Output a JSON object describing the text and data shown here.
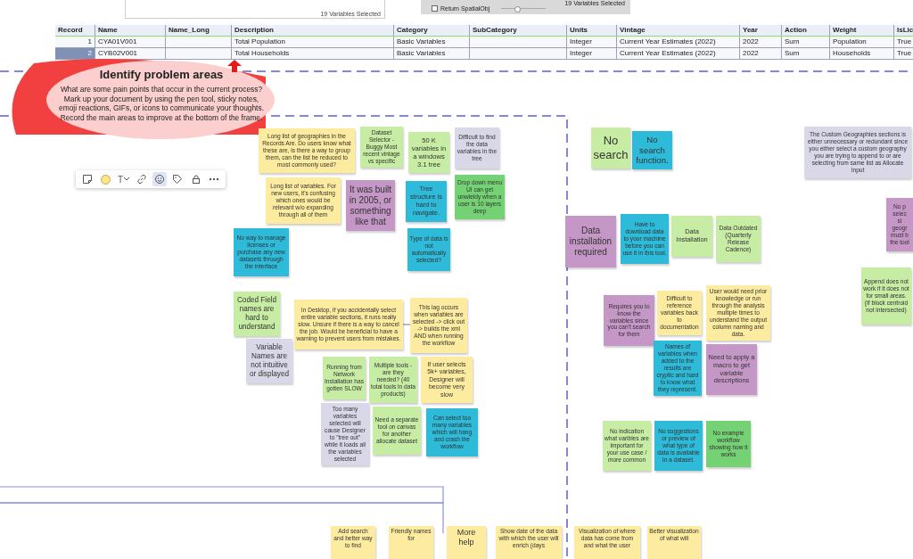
{
  "top_panels": {
    "left_status": "19 Variables Selected",
    "checkbox": {
      "label": "Return SpatialObj",
      "checked": false
    },
    "slider": {
      "level": 0.35
    },
    "right_status": "19 Variables Selected"
  },
  "table": {
    "columns": [
      "Record",
      "Name",
      "Name_Long",
      "Description",
      "Category",
      "SubCategory",
      "Units",
      "Vintage",
      "Year",
      "Action",
      "Weight",
      "IsLic"
    ],
    "rows": [
      {
        "selected": false,
        "cells": [
          "1",
          "CYA01V001",
          "",
          "Total Population",
          "Basic Variables",
          "",
          "Integer",
          "Current Year Estimates (2022)",
          "2022",
          "Sum",
          "Population",
          "True"
        ]
      },
      {
        "selected": true,
        "cells": [
          "2",
          "CYB02V001",
          "",
          "Total Households",
          "Basic Variables",
          "",
          "Integer",
          "Current Year Estimates (2022)",
          "2022",
          "Sum",
          "Households",
          "True"
        ]
      }
    ]
  },
  "callout": {
    "title": "Identify problem areas",
    "text": "What are some pain points that occur in the current process? Mark up your document by using the pen tool, sticky notes, emoji reactions, GIFs, or icons to communicate your thoughts. Record the main areas to improve at the bottom of the frame."
  },
  "toolbar": [
    {
      "kind": "sticky",
      "selected": false
    },
    {
      "kind": "swatch",
      "selected": false,
      "color": "#fde58a"
    },
    {
      "kind": "text",
      "label": "T",
      "selected": false
    },
    {
      "kind": "link",
      "selected": false
    },
    {
      "kind": "sticker",
      "selected": true
    },
    {
      "kind": "tag",
      "selected": false
    },
    {
      "kind": "lock",
      "selected": false
    },
    {
      "kind": "more",
      "selected": false
    }
  ],
  "notes": [
    {
      "text": "Long list of geographies in the Records Are. Do users know what these are, is there a way to group them, can the list be reduced to most commonly used?",
      "color": "#fdeca0"
    },
    {
      "text": "Dataset Selector - Buggy Most recent vintage vs specific",
      "color": "#c7eca4"
    },
    {
      "text": "50 K variables in a windows 3.1 tree",
      "color": "#c7eca4"
    },
    {
      "text": "Difficult to find the data variables in the tree",
      "color": "#d9d8e8"
    },
    {
      "text": "Long list of variables. For new users, it's confusing which ones would be relevant w/o expanding through all of them",
      "color": "#fdeca0"
    },
    {
      "text": "It was built in 2005, or something like that",
      "color": "#c597c7"
    },
    {
      "text": "Tree structure is hard to navigate.",
      "color": "#2dbbd9"
    },
    {
      "text": "Drop down menu UI can get unwieldy when a user is 10 layers deep",
      "color": "#74d274"
    },
    {
      "text": "No way to manage licenses or purchase any new datasets through the interface",
      "color": "#2dbbd9"
    },
    {
      "text": "Type of data is not automatically selected?",
      "color": "#2dbbd9"
    },
    {
      "text": "Coded Field names are hard to understand",
      "color": "#c7eca4"
    },
    {
      "text": "Variable Names are not intuitive or displayed",
      "color": "#d9d8e8"
    },
    {
      "text": "In Desktop, if you accidentally select entire variable sections, it runs really slow. Unsure if there is a way to cancel the job. Would be beneficial to have a warning to prevent users from mistakes.",
      "color": "#fdeca0"
    },
    {
      "text": "This lag occurs when variables are selected -> click out -> builds the xml AND when running the workflow",
      "color": "#fdeca0"
    },
    {
      "text": "Running from Network Installation has gotten SLOW",
      "color": "#c7eca4"
    },
    {
      "text": "Multiple tools - are they needed? (40 total tools in data products)",
      "color": "#c7eca4"
    },
    {
      "text": "If user selects 5k+ variables, Designer will become very slow",
      "color": "#fdeca0"
    },
    {
      "text": "Too many variables selected will cause Designer to \"tree out\" while it loads all the variables selected",
      "color": "#d9d8e8"
    },
    {
      "text": "Need a separate tool on canvas for another allocate dataset",
      "color": "#c7eca4"
    },
    {
      "text": "Can select too many variables which will hang and crash the workflow",
      "color": "#2dbbd9"
    },
    {
      "text": "No search",
      "color": "#c7eca4"
    },
    {
      "text": "No search function.",
      "color": "#2dbbd9"
    },
    {
      "text": "The Custom Geographies sections is either unnecessary or redundant since you either select a custom geography you are trying to append to or are selecting from same list as Allocate Input",
      "color": "#d9d8e8"
    },
    {
      "text": "Data installation required",
      "color": "#c597c7"
    },
    {
      "text": "Have to download data to your machine before you can use it in this tool.",
      "color": "#2dbbd9"
    },
    {
      "text": "Data Installation",
      "color": "#c7eca4"
    },
    {
      "text": "Data Outdated (Quarterly Release Cadence)",
      "color": "#c7eca4"
    },
    {
      "text": "No p\nselec\nsi\ngeogr\nmust b\nthe tool",
      "color": "#c597c7"
    },
    {
      "text": "Append does not work if it does not for small areas. (If block centroid not intersected)",
      "color": "#c7eca4"
    },
    {
      "text": "Requires you to know the variables since you can't search for them",
      "color": "#c597c7"
    },
    {
      "text": "Difficult to reference variables back to documentation",
      "color": "#fdeca0"
    },
    {
      "text": "User would need prior knowledge or run through the analysis multiple times to understand the output column naming and data.",
      "color": "#fdeca0"
    },
    {
      "text": "Names of variables when added to the results are cryptic and hard to know what they represent.",
      "color": "#2dbbd9"
    },
    {
      "text": "Need to apply a macro to get variable descriptions",
      "color": "#c597c7"
    },
    {
      "text": "No indication what varibles are important for your use case / more common",
      "color": "#c7eca4"
    },
    {
      "text": "No suggestions or preview of what type of data is available in a dataset.",
      "color": "#2dbbd9"
    },
    {
      "text": "No example workflow showing how it works",
      "color": "#74d274"
    },
    {
      "text": "Add search and better way to find",
      "color": "#fdeca0"
    },
    {
      "text": "Friendly names for",
      "color": "#fdeca0"
    },
    {
      "text": "More help",
      "color": "#fdeca0"
    },
    {
      "text": "Show date of the data with which the user will enrich (days",
      "color": "#fdeca0"
    },
    {
      "text": "Visualization of where data has come from and what the user",
      "color": "#fdeca0"
    },
    {
      "text": "Better visualization of what will",
      "color": "#fdeca0"
    }
  ]
}
